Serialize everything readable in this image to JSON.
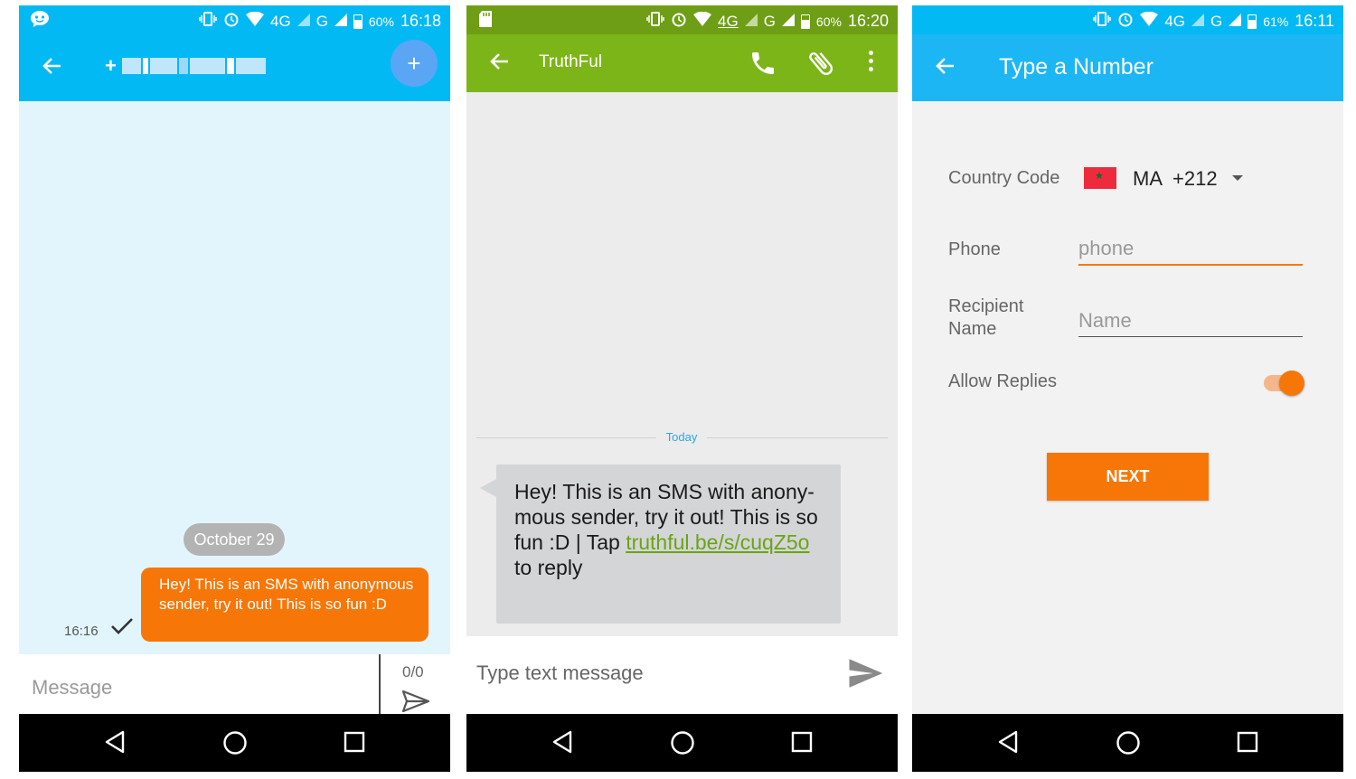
{
  "screens": {
    "messenger": {
      "status": {
        "signal_4g": "4G",
        "signal_g": "G",
        "battery": "60%",
        "time": "16:18"
      },
      "header": {
        "fab_label": "+"
      },
      "date_chip": "October 29",
      "message": {
        "text": "Hey! This is an SMS with anonymous sender, try it out! This is so fun :D",
        "time": "16:16"
      },
      "composer": {
        "placeholder": "Message",
        "counter": "0/0"
      },
      "colors": {
        "bar": "#03b9f4",
        "bubble": "#f77608"
      }
    },
    "truthful": {
      "status": {
        "signal_4g": "4G",
        "signal_g": "G",
        "battery": "60%",
        "time": "16:20"
      },
      "header": {
        "title": "TruthFul"
      },
      "divider_label": "Today",
      "message": {
        "text_before": "Hey! This is an SMS with anony-mous sender, try it out! This is so fun :D | Tap ",
        "link": "truthful.be/s/cuqZ5o",
        "text_after": " to reply"
      },
      "composer": {
        "placeholder": "Type text message"
      },
      "colors": {
        "bar": "#7cb518",
        "link": "#6aa415"
      }
    },
    "type_number": {
      "status": {
        "signal_4g": "4G",
        "signal_g": "G",
        "battery": "61%",
        "time": "16:11"
      },
      "header": {
        "title": "Type a Number"
      },
      "form": {
        "country_code_label": "Country Code",
        "country_code_value": "MA  +212",
        "phone_label": "Phone",
        "phone_placeholder": "phone",
        "recipient_label": "Recipient Name",
        "recipient_placeholder": "Name",
        "allow_replies_label": "Allow Replies",
        "allow_replies_on": true,
        "next_label": "NEXT"
      },
      "colors": {
        "bar": "#1db6f5",
        "accent": "#f77608"
      }
    }
  }
}
